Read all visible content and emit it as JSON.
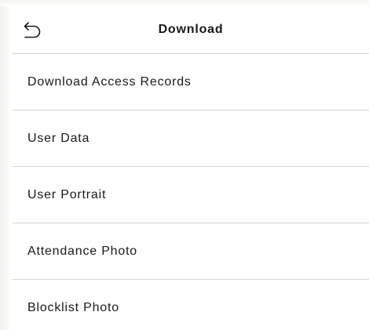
{
  "header": {
    "title": "Download",
    "back_icon": "back-arrow-icon"
  },
  "menu": {
    "items": [
      {
        "label": "Download Access Records"
      },
      {
        "label": "User Data"
      },
      {
        "label": "User Portrait"
      },
      {
        "label": "Attendance Photo"
      },
      {
        "label": "Blocklist Photo"
      }
    ]
  },
  "colors": {
    "background": "#ffffff",
    "divider": "#d4d4d4",
    "text": "#1a1a1a"
  }
}
